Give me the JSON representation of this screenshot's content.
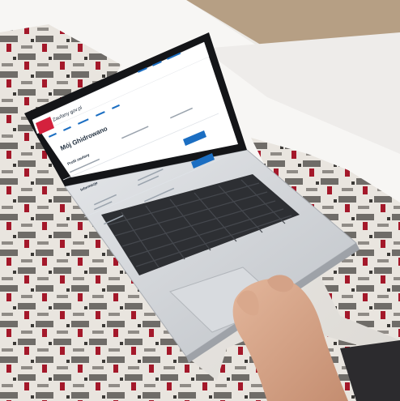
{
  "screen": {
    "logo_text": "Zaufany gov.pl",
    "page_title": "Mój Ghidrowano",
    "section_1": "Profil zaufany",
    "section_2": "Informacje"
  },
  "colors": {
    "gov_red": "#d4213d",
    "gov_blue": "#1b6ec2",
    "laptop_silver": "#cfd2d6",
    "blanket_red": "#a4182a",
    "blanket_grey": "#6f6c68"
  }
}
